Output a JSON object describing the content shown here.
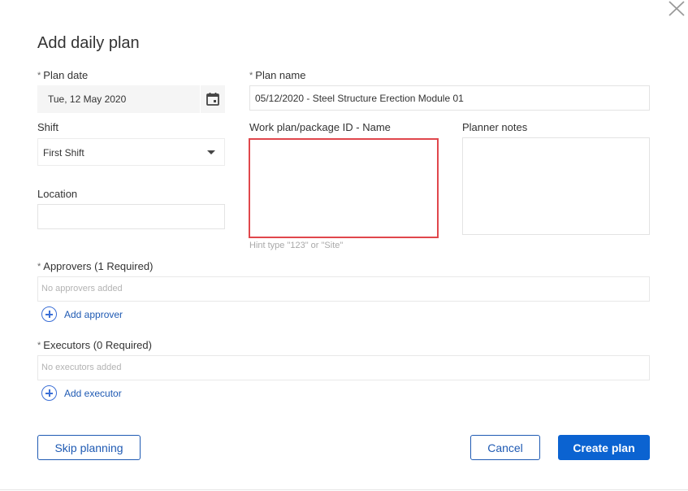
{
  "dialog": {
    "title": "Add daily plan"
  },
  "form": {
    "required_marker": "*",
    "plan_date": {
      "label": "Plan date",
      "value": "Tue, 12 May 2020"
    },
    "plan_name": {
      "label": "Plan name",
      "value": "05/12/2020 - Steel Structure Erection Module 01"
    },
    "shift": {
      "label": "Shift",
      "value": "First Shift"
    },
    "work_plan": {
      "label": "Work plan/package ID - Name",
      "value": "",
      "hint": "Hint type \"123\" or \"Site\""
    },
    "planner_notes": {
      "label": "Planner notes",
      "value": ""
    },
    "location": {
      "label": "Location",
      "value": ""
    }
  },
  "approvers": {
    "label": "Approvers (1 Required)",
    "empty_text": "No approvers added",
    "add_label": "Add approver"
  },
  "executors": {
    "label": "Executors (0 Required)",
    "empty_text": "No executors added",
    "add_label": "Add executor"
  },
  "actions": {
    "skip_label": "Skip planning",
    "cancel_label": "Cancel",
    "create_label": "Create plan"
  },
  "icons": {
    "close": "close-icon",
    "calendar": "calendar-icon",
    "dropdown": "chevron-down-icon",
    "add": "plus-circle-icon"
  },
  "colors": {
    "primary": "#0b63d1",
    "link": "#1f5ab3",
    "focus_border": "#e0474c",
    "hint": "#a9a9a9"
  }
}
